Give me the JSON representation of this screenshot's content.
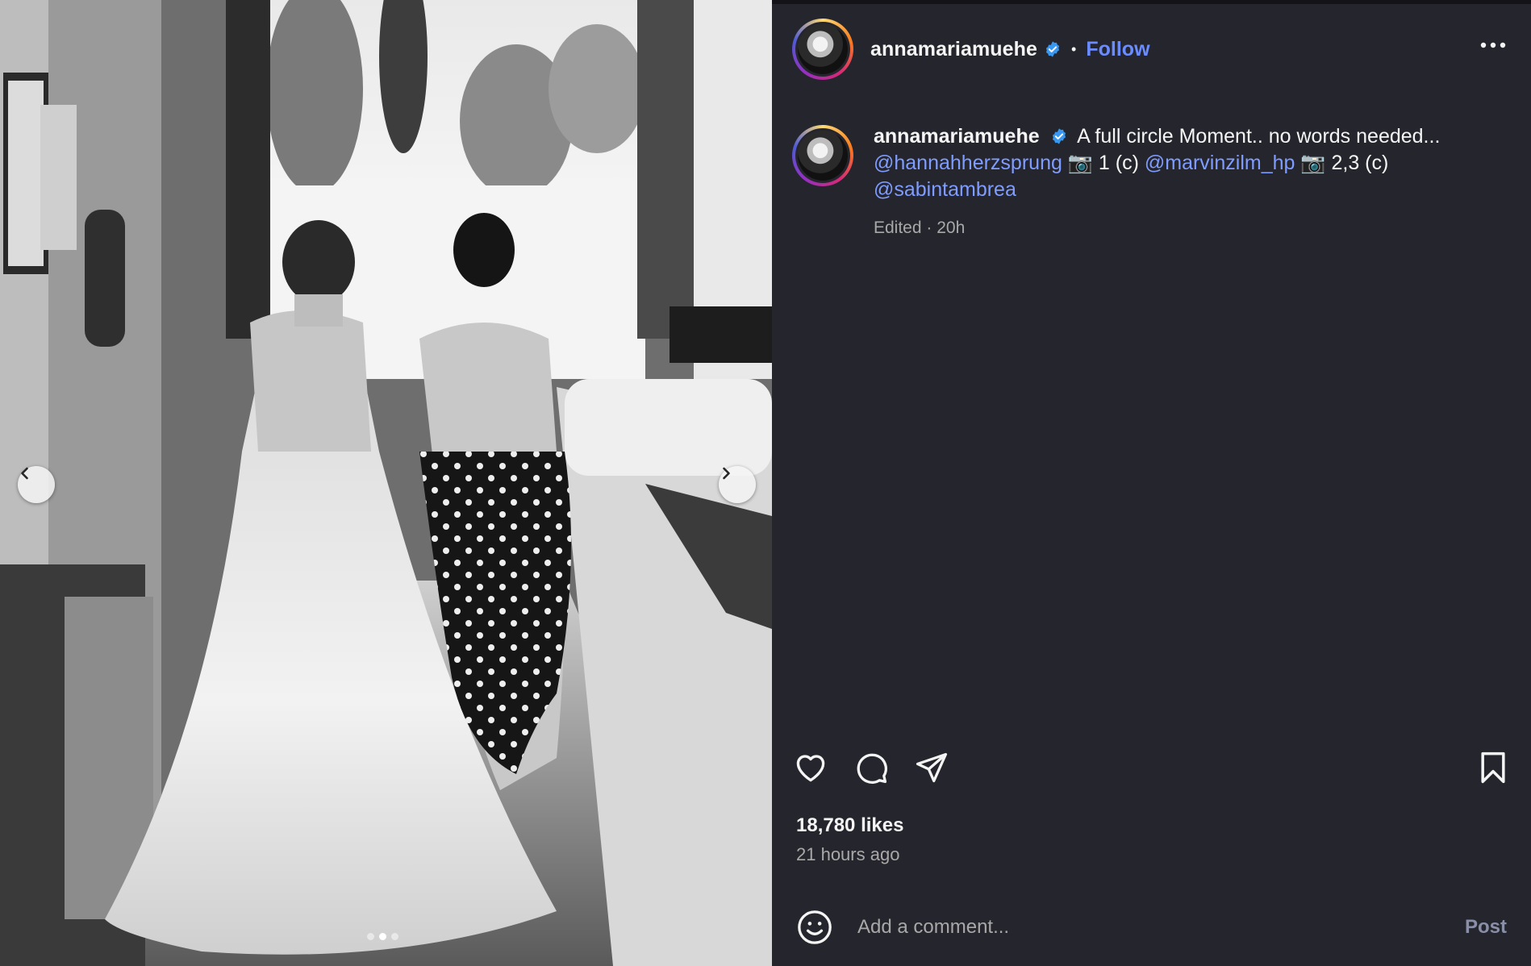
{
  "post": {
    "username": "annamariamuehe",
    "follow_label": "Follow",
    "separator": "•",
    "caption": {
      "text": "A full circle Moment.. no words needed...",
      "mention_1": "@hannahherzsprung",
      "credit_1": "1 (c)",
      "mention_2": "@marvinzilm_hp",
      "credit_2": "2,3 (c)",
      "mention_3": "@sabintambrea",
      "camera_emoji": "📷"
    },
    "edited_meta": "Edited · 20h",
    "likes": "18,780 likes",
    "posted_time": "21 hours ago",
    "comment": {
      "placeholder": "Add a comment...",
      "post_label": "Post"
    },
    "carousel": {
      "count": 3,
      "active_index": 1
    }
  },
  "colors": {
    "accent_link": "#6b8cff",
    "verified": "#3897f0",
    "panel_bg": "#25262d"
  }
}
